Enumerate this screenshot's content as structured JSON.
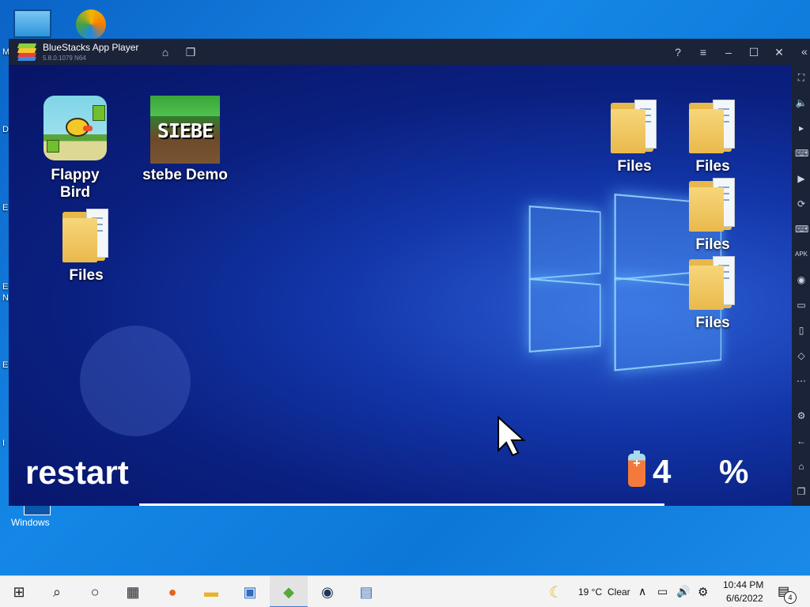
{
  "desktop": {
    "shortcut_label": "Windows",
    "edge_letters": [
      "M",
      "D",
      "E",
      "E",
      "N",
      "E",
      "I"
    ]
  },
  "window": {
    "title": "BlueStacks App Player",
    "version": "5.8.0.1079 N64"
  },
  "android": {
    "apps": [
      {
        "label": "Flappy Bird"
      },
      {
        "label": "stebe Demo",
        "icon_text": "SIEBE"
      }
    ],
    "folders": [
      {
        "label": "Files"
      },
      {
        "label": "Files"
      },
      {
        "label": "Files"
      },
      {
        "label": "Files"
      },
      {
        "label": "Files"
      }
    ],
    "restart_label": "restart",
    "battery_level": "4",
    "battery_percent": "%",
    "battery_glyph": "+"
  },
  "taskbar": {
    "weather_temp": "19 °C",
    "weather_condition": "Clear",
    "time": "10:44 PM",
    "date": "6/6/2022",
    "notification_count": "4"
  },
  "colors": {
    "taskbar_accent": "#3c7ad6",
    "bluestacks_titlebar": "#1b2338",
    "folder_yellow": "#f7d67a"
  }
}
